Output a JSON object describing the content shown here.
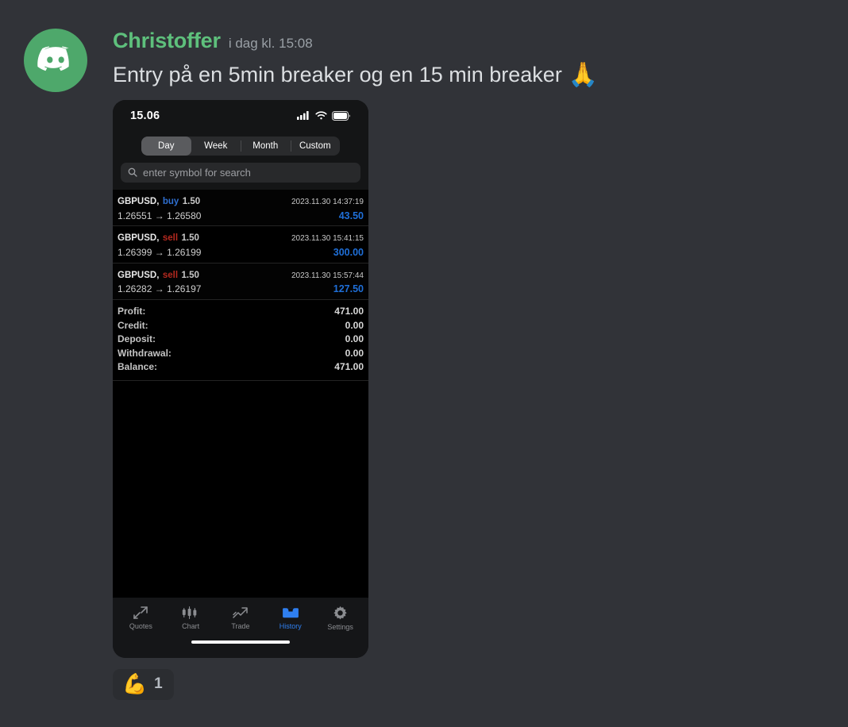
{
  "message": {
    "author": "Christoffer",
    "timestamp": "i dag kl. 15:08",
    "text": "Entry på en 5min breaker og en 15 min breaker",
    "trailing_emoji": "🙏",
    "avatar_icon": "discord-logo-icon",
    "avatar_color": "#4ea86b",
    "username_color": "#5ec07c"
  },
  "reactions": [
    {
      "emoji": "💪",
      "emoji_name": "flexed-biceps",
      "count": "1"
    }
  ],
  "phone": {
    "status_bar": {
      "time": "15.06",
      "icons": [
        "cellular-signal-icon",
        "wifi-icon",
        "battery-icon"
      ]
    },
    "segmented_control": {
      "options": [
        "Day",
        "Week",
        "Month",
        "Custom"
      ],
      "selected": "Day"
    },
    "search": {
      "placeholder": "enter symbol for search",
      "value": "",
      "icon": "search-icon"
    },
    "trades": [
      {
        "symbol": "GBPUSD,",
        "side": "buy",
        "volume": "1.50",
        "datetime": "2023.11.30 14:37:19",
        "open_price": "1.26551",
        "arrow": "→",
        "close_price": "1.26580",
        "profit": "43.50"
      },
      {
        "symbol": "GBPUSD,",
        "side": "sell",
        "volume": "1.50",
        "datetime": "2023.11.30 15:41:15",
        "open_price": "1.26399",
        "arrow": "→",
        "close_price": "1.26199",
        "profit": "300.00"
      },
      {
        "symbol": "GBPUSD,",
        "side": "sell",
        "volume": "1.50",
        "datetime": "2023.11.30 15:57:44",
        "open_price": "1.26282",
        "arrow": "→",
        "close_price": "1.26197",
        "profit": "127.50"
      }
    ],
    "summary": [
      {
        "label": "Profit:",
        "value": "471.00"
      },
      {
        "label": "Credit:",
        "value": "0.00"
      },
      {
        "label": "Deposit:",
        "value": "0.00"
      },
      {
        "label": "Withdrawal:",
        "value": "0.00"
      },
      {
        "label": "Balance:",
        "value": "471.00"
      }
    ],
    "tabbar": {
      "items": [
        {
          "label": "Quotes",
          "icon": "quotes-arrow-icon",
          "active": false
        },
        {
          "label": "Chart",
          "icon": "candlestick-chart-icon",
          "active": false
        },
        {
          "label": "Trade",
          "icon": "trade-trend-icon",
          "active": false
        },
        {
          "label": "History",
          "icon": "history-inbox-icon",
          "active": true
        },
        {
          "label": "Settings",
          "icon": "gear-icon",
          "active": false
        }
      ],
      "active_color": "#2f7ff0"
    }
  }
}
